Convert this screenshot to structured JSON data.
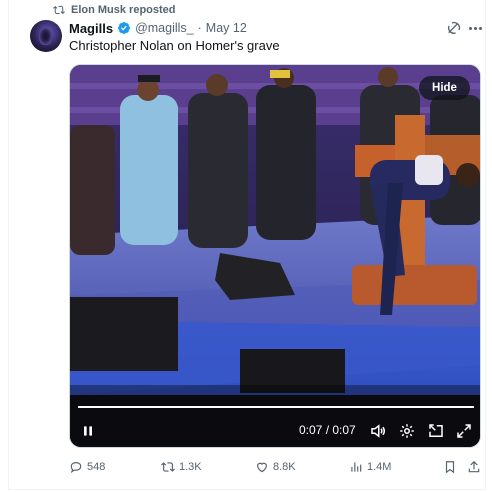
{
  "repost": {
    "label": "Elon Musk reposted",
    "icon": "repost-icon"
  },
  "author": {
    "name": "Magills",
    "handle": "@magills_",
    "separator": "·",
    "date": "May 12",
    "verified_color": "#1d9bf0"
  },
  "tweet": {
    "text": "Christopher Nolan on Homer's grave"
  },
  "media": {
    "hide_label": "Hide",
    "time": "0:07 / 0:07",
    "progress": 1.0
  },
  "actions": {
    "replies": "548",
    "reposts": "1.3K",
    "likes": "8.8K",
    "views": "1.4M"
  },
  "colors": {
    "accent": "#1d9bf0",
    "muted": "#536471",
    "text": "#0f1419"
  }
}
